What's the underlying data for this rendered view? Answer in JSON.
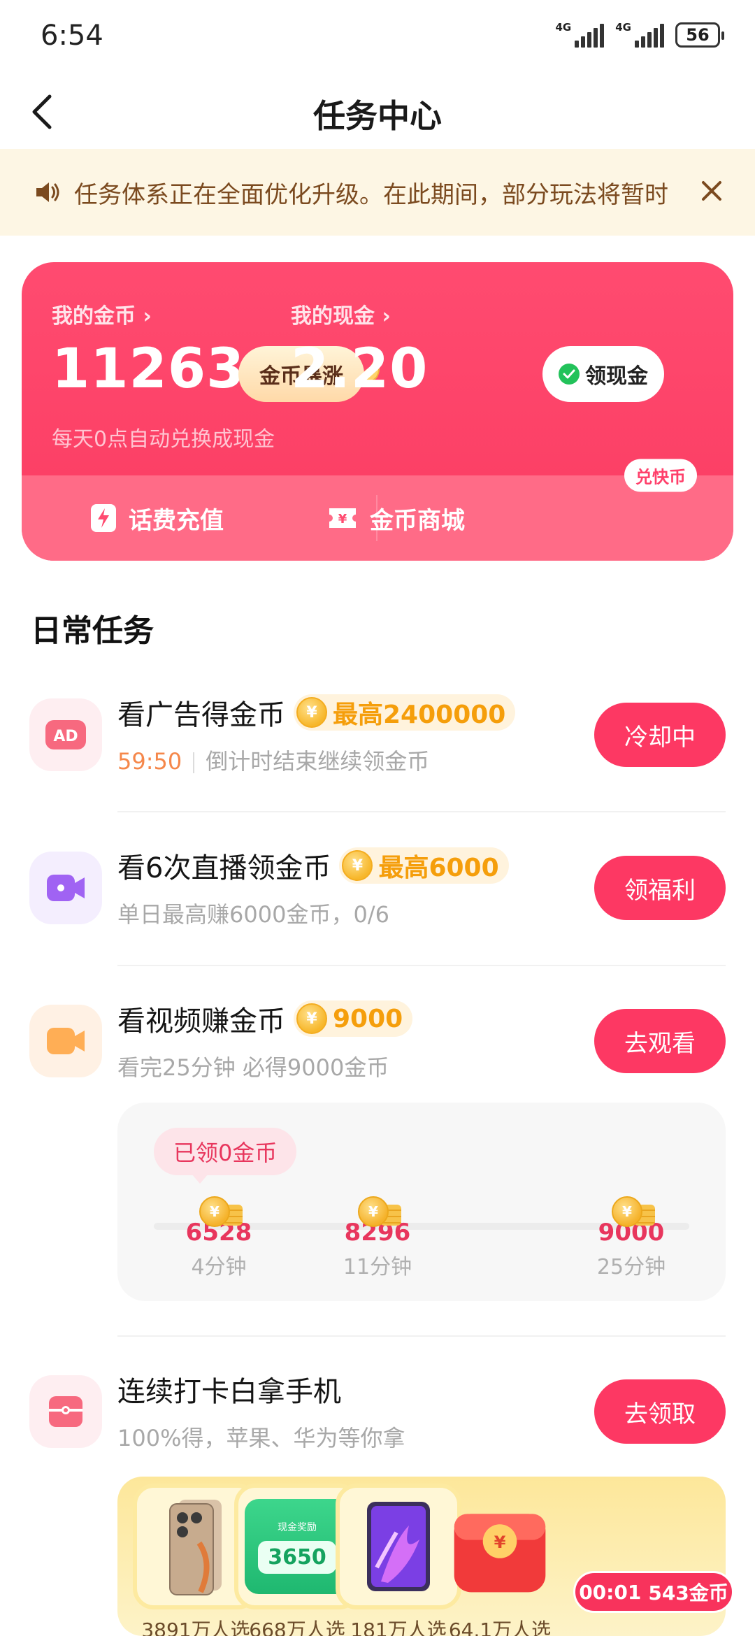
{
  "status_bar": {
    "time": "6:54",
    "signal1": "4G",
    "signal2": "4G",
    "battery": "56"
  },
  "header": {
    "title": "任务中心"
  },
  "notice": {
    "text": "任务体系正在全面优化升级。在此期间，部分玩法将暂时"
  },
  "wallet": {
    "coins_label": "我的金币 ›",
    "coins_value": "11263",
    "coins_button": "金币暴涨",
    "cash_label": "我的现金 ›",
    "cash_value": "2.20",
    "cash_button": "领现金",
    "sub_text": "每天0点自动兑换成现金",
    "phone_topup": "话费充值",
    "coin_mall": "金币商城",
    "mall_badge": "兑快币"
  },
  "section_title": "日常任务",
  "tasks": [
    {
      "title": "看广告得金币",
      "reward": "最高2400000",
      "countdown": "59:50",
      "subtitle": "倒计时结束继续领金币",
      "button": "冷却中"
    },
    {
      "title": "看6次直播领金币",
      "reward": "最高6000",
      "subtitle": "单日最高赚6000金币，0/6",
      "button": "领福利"
    },
    {
      "title": "看视频赚金币",
      "reward": "9000",
      "subtitle": "看完25分钟 必得9000金币",
      "button": "去观看"
    },
    {
      "title": "连续打卡白拿手机",
      "subtitle": "100%得，苹果、华为等你拿",
      "button": "去领取"
    }
  ],
  "video_progress": {
    "earned": "已领0金币",
    "milestones": [
      {
        "value": "6528",
        "time": "4分钟"
      },
      {
        "value": "8296",
        "time": "11分钟"
      },
      {
        "value": "9000",
        "time": "25分钟"
      }
    ]
  },
  "prizes": [
    {
      "count": "3891万人选"
    },
    {
      "count": "668万人选",
      "label": "现金奖励",
      "amount": "3650"
    },
    {
      "count": "181万人选"
    },
    {
      "count": "64.1万人选"
    }
  ],
  "float_timer": {
    "time": "00:01",
    "coins": "543金币"
  },
  "colors": {
    "primary": "#fd3863",
    "gold": "#f59e0b",
    "notice_bg": "#fdf6e4"
  }
}
